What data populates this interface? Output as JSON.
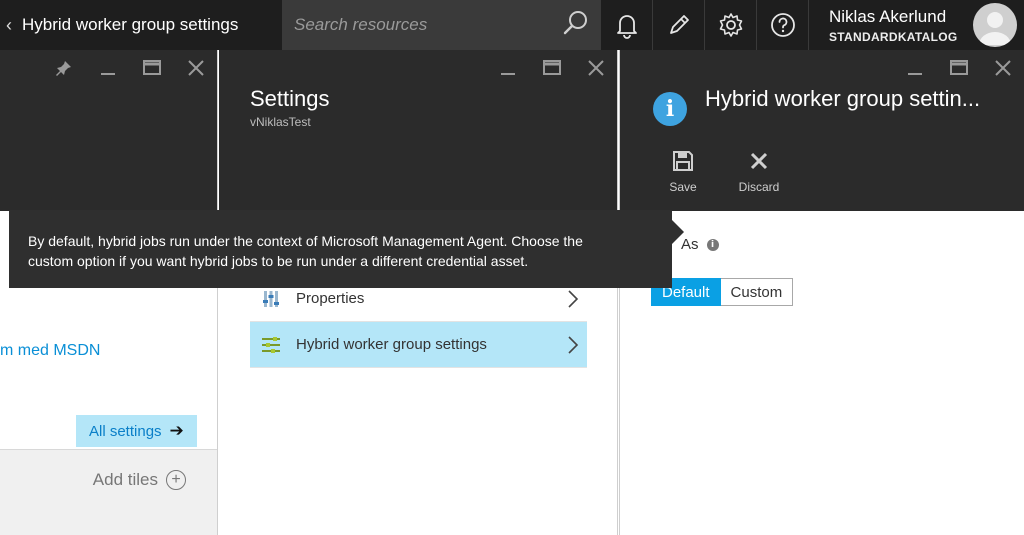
{
  "topbar": {
    "breadcrumb_title": "Hybrid worker group settings",
    "search_placeholder": "Search resources",
    "user_name": "Niklas Akerlund",
    "user_directory": "STANDARDKATALOG"
  },
  "blade_left": {
    "link_text": "m med MSDN",
    "all_settings_label": "All settings",
    "add_tiles_label": "Add tiles"
  },
  "blade_settings": {
    "title": "Settings",
    "subtitle": "vNiklasTest",
    "menu": [
      {
        "label": "Properties"
      },
      {
        "label": "Hybrid worker group settings"
      }
    ]
  },
  "blade_hybrid": {
    "title": "Hybrid worker group settin...",
    "save_label": "Save",
    "discard_label": "Discard",
    "run_as_label": "As",
    "toggle_default": "Default",
    "toggle_custom": "Custom"
  },
  "tooltip": {
    "line1": "By default, hybrid jobs run under the context of Microsoft Management Agent. Choose the",
    "line2": "custom option if you want hybrid jobs to be run under a different credential asset."
  },
  "colors": {
    "accent": "#0aa0e4",
    "selected_bg": "#b4e6f8",
    "blade_header": "#2b2b2b",
    "topbar": "#1e1e1e"
  }
}
